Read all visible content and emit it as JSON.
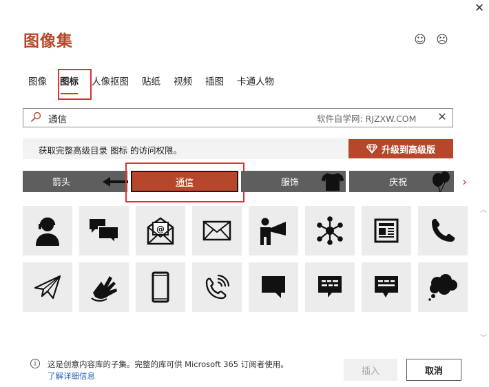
{
  "dialog": {
    "title": "图像集",
    "close_label": "✕",
    "smile_label": "☺",
    "frown_label": "☹"
  },
  "tabs": [
    {
      "label": "图像"
    },
    {
      "label": "图标",
      "active": true
    },
    {
      "label": "人像抠图"
    },
    {
      "label": "贴纸"
    },
    {
      "label": "视频"
    },
    {
      "label": "插图"
    },
    {
      "label": "卡通人物"
    }
  ],
  "search": {
    "value": "通信",
    "watermark": "软件自学网: RJZXW.COM",
    "clear_label": "✕"
  },
  "banner": {
    "text": "获取完整高级目录 图标 的访问权限。",
    "upgrade_label": "升级到高级版"
  },
  "categories": [
    {
      "label": "箭头",
      "icon": "arrow-left-icon"
    },
    {
      "label": "通信",
      "active": true
    },
    {
      "label": "服饰",
      "icon": "tshirt-icon"
    },
    {
      "label": "庆祝",
      "icon": "balloons-icon"
    }
  ],
  "next_arrow": "›",
  "icons_row1": [
    "headset-person-icon",
    "chat-bubbles-icon",
    "email-open-icon",
    "envelope-icon",
    "megaphone-person-icon",
    "network-hub-icon",
    "newspaper-icon",
    "phone-handset-icon"
  ],
  "icons_row2": [
    "paper-plane-icon",
    "sign-language-icon",
    "mobile-phone-icon",
    "phone-ringing-icon",
    "speech-bubble-icon",
    "text-message-icon",
    "comment-icon",
    "thought-bubble-icon"
  ],
  "footer": {
    "info_glyph": "i",
    "info_text": "这是创意内容库的子集。完整的库可供 Microsoft 365 订阅者使用。",
    "learn_more": "了解详细信息",
    "insert_label": "插入",
    "cancel_label": "取消"
  },
  "colors": {
    "accent": "#b7472a",
    "category_bg": "#5e5e5e",
    "tile_bg": "#ececec",
    "highlight": "#e03030",
    "link": "#2563b8"
  }
}
